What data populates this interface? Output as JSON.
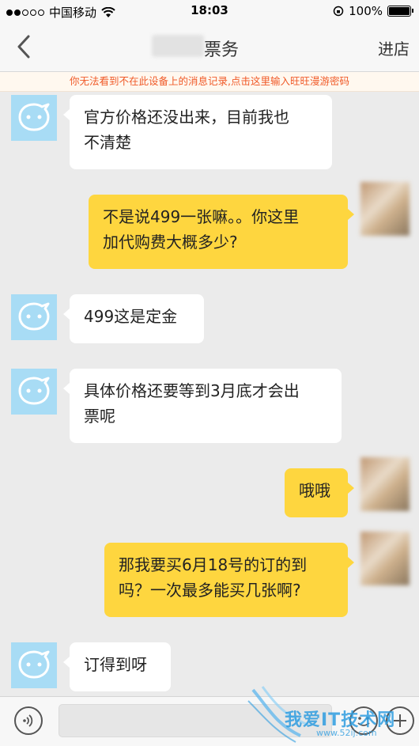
{
  "status_bar": {
    "carrier": "中国移动",
    "time": "18:03",
    "battery": "100%",
    "battery_level": 1.0
  },
  "nav": {
    "title_visible": "票务",
    "store_button": "进店",
    "back_icon": "chevron-left-icon"
  },
  "notice": "你无法看到不在此设备上的消息记录,点击这里输入旺旺漫游密码",
  "messages": [
    {
      "side": "in",
      "lines": [
        "官方价格还没出来，目前我也",
        "不清楚"
      ]
    },
    {
      "side": "out",
      "lines": [
        "不是说499一张嘛。。你这里",
        "加代购费大概多少?"
      ]
    },
    {
      "side": "in",
      "lines": [
        "499这是定金"
      ]
    },
    {
      "side": "in",
      "lines": [
        "具体价格还要等到3月底才会出",
        "票呢"
      ]
    },
    {
      "side": "out",
      "lines": [
        "哦哦"
      ]
    },
    {
      "side": "out",
      "lines": [
        "那我要买6月18号的订的到",
        "吗？一次最多能买几张啊?"
      ]
    },
    {
      "side": "in",
      "lines": [
        "订得到呀"
      ]
    }
  ],
  "input_bar": {
    "voice_icon": "voice-icon",
    "emoji_icon": "emoji-icon",
    "plus_icon": "plus-icon"
  },
  "watermark": {
    "text": "我爱IT技术网",
    "url": "www.52ij.com"
  },
  "colors": {
    "incoming_bubble": "#ffffff",
    "outgoing_bubble": "#fed63f",
    "notice_text": "#f05a28",
    "avatar_bg": "#a8dcf5"
  }
}
